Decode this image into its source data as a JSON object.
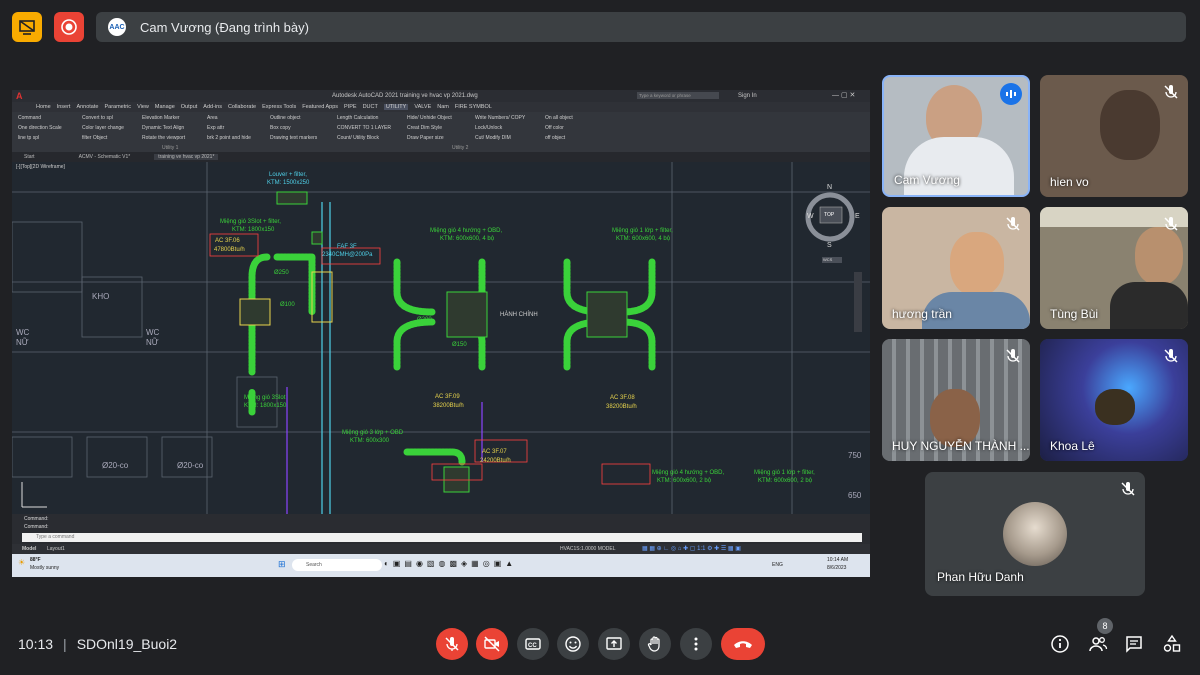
{
  "top_bar": {
    "presenter_text": "Cam Vương (Đang trình bày)",
    "presenter_logo": "AAC"
  },
  "shared_screen": {
    "title": "Autodesk AutoCAD 2021    training ve hvac vp 2021.dwg",
    "search_placeholder": "Type a keyword or phrase",
    "sign_in": "Sign In",
    "menu_tabs": [
      "Home",
      "Insert",
      "Annotate",
      "Parametric",
      "View",
      "Manage",
      "Output",
      "Add-ins",
      "Collaborate",
      "Express Tools",
      "Featured Apps",
      "PIPE",
      "DUCT",
      "UTILITY",
      "VALVE",
      "Nam",
      "FIRE SYMBOL"
    ],
    "ribbon": {
      "col1": [
        "Command",
        "One direction Scale",
        "line tp spl"
      ],
      "col2": [
        "Convert to spl",
        "Color layer change",
        "filter Object"
      ],
      "col3": [
        "Elevation Marker",
        "Dynamic Text Align",
        "Rotate the viewport"
      ],
      "col4": [
        "Area",
        "Exp attr",
        "brk 2 point and hide"
      ],
      "col5": [
        "Outline object",
        "Box copy",
        "Drawing text markers"
      ],
      "col6": [
        "Length Calculation",
        "CONVERT TO 1 LAYER",
        "Count/ Utility Block"
      ],
      "col7": [
        "Hide/ Unhide Object",
        "Creat Dim Style",
        "Draw Paper size"
      ],
      "col8": [
        "Write Numbers/ COPY",
        "Lock/Unlock",
        "Cut/ Modify DIM"
      ],
      "col9": [
        "On all object",
        "Off color",
        "off object"
      ],
      "panel1": "Utility 1",
      "panel2": "Utility 2"
    },
    "doc_tabs": [
      "Start",
      "ACMV - Schematic V1*",
      "training ve hvac vp 2021*"
    ],
    "viewport_label": "[-][Top][2D Wireframe]",
    "viewcube": {
      "n": "N",
      "s": "S",
      "e": "E",
      "w": "W",
      "top": "TOP",
      "wcs": "WCS"
    },
    "cad_labels": {
      "louver": "Louver + filter,",
      "louver2": "KTM: 1500x250",
      "fafl": "FAF 3F",
      "fafl2": "2340CMH@200Pa",
      "mg1": "Miệng gió 3Slot + filter,",
      "mg1b": "KTM: 1800x150",
      "ac306": "AC 3F.06",
      "ac306b": "47800Btu/h",
      "mg2": "Miệng gió 4 hướng + OBD,",
      "mg2b": "KTM: 600x600, 4 bộ",
      "mg3": "Miệng gió 1 lớp + filter,",
      "mg3b": "KTM: 600x600, 4 bộ",
      "hanhchinh": "HÀNH CHÍNH",
      "ac309": "AC 3F.09",
      "ac309b": "38200Btu/h",
      "ac308": "AC 3F.08",
      "ac308b": "38200Btu/h",
      "mg4": "Miệng gió 3Slot",
      "mg4b": "KTM: 1800x150",
      "mg5": "Miệng gió 3 lớp + OBD",
      "mg5b": "KTM: 600x300",
      "ac307": "AC 3F.07",
      "ac307b": "24200Btu/h",
      "mg6": "Miệng gió 4 hướng + OBD,",
      "mg6b": "KTM: 600x600, 2 bộ",
      "mg7": "Miệng gió 1 lớp + filter,",
      "mg7b": "KTM: 600x600, 2 bộ",
      "kho": "KHO",
      "wc1": "WC",
      "wc2": "NỮ",
      "wc3": "WC",
      "wc4": "NỮ",
      "d250": "Ø250",
      "d100": "Ø100",
      "d150": "Ø150",
      "d200": "Ø200",
      "co1": "Ø20-co",
      "co2": "Ø20-co",
      "num750": "750",
      "num650": "650"
    },
    "command1": "Command:",
    "command2": "Command:",
    "command_placeholder": "Type a command",
    "layout_tabs": [
      "Model",
      "Layout1"
    ],
    "status_scale": "HVAC1S:1.0000   MODEL",
    "weather": "88°F",
    "weather2": "Mostly sunny",
    "taskbar_search": "Search",
    "tray_lang": "ENG",
    "tray_time": "10:14 AM",
    "tray_date": "8/6/2023"
  },
  "participants": [
    {
      "name": "Cam Vương",
      "muted": false,
      "speaking": true
    },
    {
      "name": "hien vo",
      "muted": true
    },
    {
      "name": "hương trần",
      "muted": true
    },
    {
      "name": "Tùng Bùi",
      "muted": true
    },
    {
      "name": "HUY NGUYỄN THÀNH ...",
      "muted": true
    },
    {
      "name": "Khoa Lê",
      "muted": true
    },
    {
      "name": "Phan Hữu Danh",
      "muted": true
    }
  ],
  "bottom_bar": {
    "time": "10:13",
    "separator": "|",
    "meeting_name": "SDOnl19_Buoi2",
    "participant_count": "8"
  },
  "icons": [
    "present-icon",
    "record-icon",
    "mic-off-icon",
    "camera-off-icon",
    "captions-icon",
    "emoji-icon",
    "present-screen-icon",
    "raise-hand-icon",
    "more-options-icon",
    "leave-call-icon",
    "info-icon",
    "people-icon",
    "chat-icon",
    "activities-icon"
  ],
  "colors": {
    "accent_yellow": "#f9ab00",
    "record_red": "#ea4335",
    "cad_green": "#3ad23a",
    "cad_yellow": "#e8d44d",
    "cad_red": "#ff4040",
    "cad_cyan": "#4fd0e8"
  }
}
